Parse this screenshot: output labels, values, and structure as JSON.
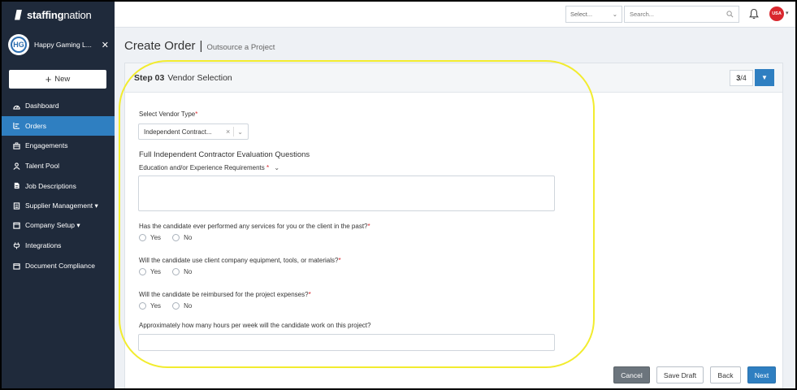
{
  "brand": {
    "name_bold": "staffing",
    "name_light": "nation"
  },
  "company": {
    "initials": "HG",
    "name": "Happy Gaming L...",
    "close": "✕"
  },
  "sidebar": {
    "new_label": "New",
    "items": [
      {
        "label": "Dashboard",
        "icon": "dashboard-icon"
      },
      {
        "label": "Orders",
        "icon": "orders-icon",
        "active": true
      },
      {
        "label": "Engagements",
        "icon": "engagements-icon"
      },
      {
        "label": "Talent Pool",
        "icon": "person-icon"
      },
      {
        "label": "Job Descriptions",
        "icon": "document-icon"
      },
      {
        "label": "Supplier Management ▾",
        "icon": "supplier-icon"
      },
      {
        "label": "Company Setup ▾",
        "icon": "company-icon"
      },
      {
        "label": "Integrations",
        "icon": "plug-icon"
      },
      {
        "label": "Document Compliance",
        "icon": "folder-icon"
      }
    ]
  },
  "topbar": {
    "select_placeholder": "Select...",
    "search_placeholder": "Search...",
    "user_initials": "USA"
  },
  "page": {
    "title": "Create Order",
    "separator": "|",
    "subtitle": "Outsource a Project"
  },
  "step": {
    "label": "Step 03",
    "name": "Vendor Selection",
    "current": "3",
    "total": "/4"
  },
  "form": {
    "vendor_type_label": "Select Vendor Type",
    "vendor_type_value": "Independent Contract...",
    "section_title": "Full Independent Contractor Evaluation Questions",
    "education_label": "Education and/or Experience Requirements",
    "q1": "Has the candidate ever performed any services for you or the client in the past?",
    "q2": "Will the candidate use client company equipment, tools, or materials?",
    "q3": "Will the candidate be reimbursed for the project expenses?",
    "q4": "Approximately how many hours per week will the candidate work on this project?",
    "yes": "Yes",
    "no": "No",
    "required_mark": "*"
  },
  "buttons": {
    "cancel": "Cancel",
    "save_draft": "Save Draft",
    "back": "Back",
    "next": "Next"
  },
  "colors": {
    "sidebar": "#1f2a3b",
    "accent": "#2f7fc1",
    "highlight": "#f2ec2e",
    "required": "#d9272e"
  }
}
